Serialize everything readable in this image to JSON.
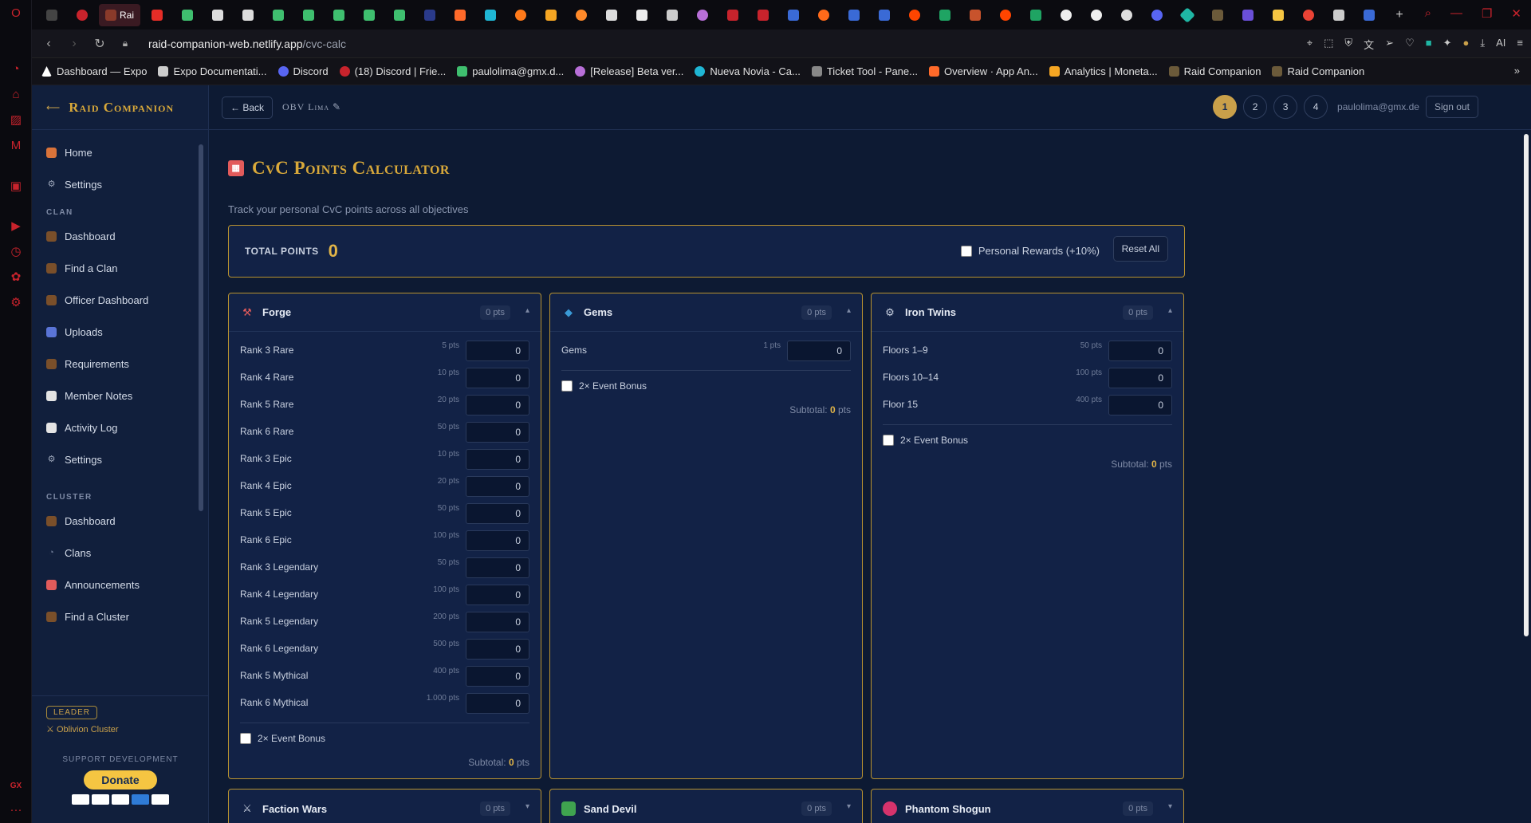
{
  "browser": {
    "active_tab_label": "Rai",
    "url_host": "raid-companion-web.netlify.app",
    "url_path": "/cvc-calc",
    "bookmarks": [
      {
        "label": "Dashboard — Expo",
        "color": "#ffffff"
      },
      {
        "label": "Expo Documentati...",
        "color": "#cccccc"
      },
      {
        "label": "Discord",
        "color": "#5865f2"
      },
      {
        "label": "(18) Discord | Frie...",
        "color": "#c8232c"
      },
      {
        "label": "paulolima@gmx.d...",
        "color": "#3fbf6f"
      },
      {
        "label": "[Release] Beta ver...",
        "color": "#b86fd8"
      },
      {
        "label": "Nueva Novia - Ca...",
        "color": "#1fb6d4"
      },
      {
        "label": "Ticket Tool - Pane...",
        "color": "#888888"
      },
      {
        "label": "Overview · App An...",
        "color": "#ff6a2a"
      },
      {
        "label": "Analytics | Moneta...",
        "color": "#f5a623"
      },
      {
        "label": "Raid Companion",
        "color": "#6b5a3a"
      },
      {
        "label": "Raid Companion",
        "color": "#6b5a3a"
      }
    ]
  },
  "brand": {
    "name": "Raid Companion"
  },
  "sidebar": {
    "top": [
      {
        "label": "Home",
        "icon": "house-icon",
        "color": "#d9733a"
      },
      {
        "label": "Settings",
        "icon": "gear-icon",
        "color": "#9aa4b8"
      }
    ],
    "clan_heading": "CLAN",
    "clan": [
      {
        "label": "Dashboard",
        "icon": "dashboard-icon",
        "color": "#7a4f2a"
      },
      {
        "label": "Find a Clan",
        "icon": "search-clan-icon",
        "color": "#7a4f2a"
      },
      {
        "label": "Officer Dashboard",
        "icon": "officer-icon",
        "color": "#7a4f2a"
      },
      {
        "label": "Uploads",
        "icon": "upload-icon",
        "color": "#5a74d6"
      },
      {
        "label": "Requirements",
        "icon": "requirements-icon",
        "color": "#7a4f2a"
      },
      {
        "label": "Member Notes",
        "icon": "notes-icon",
        "color": "#e4e4e4"
      },
      {
        "label": "Activity Log",
        "icon": "log-icon",
        "color": "#e4e4e4"
      },
      {
        "label": "Settings",
        "icon": "gear-icon",
        "color": "#9aa4b8"
      }
    ],
    "cluster_heading": "CLUSTER",
    "cluster": [
      {
        "label": "Dashboard",
        "icon": "dashboard-icon",
        "color": "#7a4f2a"
      },
      {
        "label": "Clans",
        "icon": "clans-icon",
        "color": "#6f7c98"
      },
      {
        "label": "Announcements",
        "icon": "megaphone-icon",
        "color": "#e25b5b"
      },
      {
        "label": "Find a Cluster",
        "icon": "search-cluster-icon",
        "color": "#7a4f2a"
      }
    ],
    "footer": {
      "role_badge": "LEADER",
      "cluster_name": "Oblivion Cluster",
      "support_label": "SUPPORT DEVELOPMENT",
      "donate_label": "Donate"
    }
  },
  "topbar": {
    "back_label": "← Back",
    "clan_name": "OBV Lima ✎",
    "slots": [
      "1",
      "2",
      "3",
      "4"
    ],
    "active_slot": "1",
    "email": "paulolima@gmx.de",
    "signout_label": "Sign out"
  },
  "page": {
    "title": "CvC Points Calculator",
    "subtitle": "Track your personal CvC points across all objectives",
    "total_label": "TOTAL POINTS",
    "total_value": "0",
    "personal_rewards_label": "Personal Rewards (+10%)",
    "reset_label": "Reset All",
    "event_bonus_label": "2× Event Bonus",
    "subtotal_label": "Subtotal:",
    "subtotal_suffix": "pts"
  },
  "categories": [
    {
      "name": "Forge",
      "icon": "hammers-icon",
      "pts_badge": "0 pts",
      "subtotal": "0",
      "rows": [
        {
          "label": "Rank 3 Rare",
          "pts": "5 pts",
          "value": "0"
        },
        {
          "label": "Rank 4 Rare",
          "pts": "10 pts",
          "value": "0"
        },
        {
          "label": "Rank 5 Rare",
          "pts": "20 pts",
          "value": "0"
        },
        {
          "label": "Rank 6 Rare",
          "pts": "50 pts",
          "value": "0"
        },
        {
          "label": "Rank 3 Epic",
          "pts": "10 pts",
          "value": "0"
        },
        {
          "label": "Rank 4 Epic",
          "pts": "20 pts",
          "value": "0"
        },
        {
          "label": "Rank 5 Epic",
          "pts": "50 pts",
          "value": "0"
        },
        {
          "label": "Rank 6 Epic",
          "pts": "100 pts",
          "value": "0"
        },
        {
          "label": "Rank 3 Legendary",
          "pts": "50 pts",
          "value": "0"
        },
        {
          "label": "Rank 4 Legendary",
          "pts": "100 pts",
          "value": "0"
        },
        {
          "label": "Rank 5 Legendary",
          "pts": "200 pts",
          "value": "0"
        },
        {
          "label": "Rank 6 Legendary",
          "pts": "500 pts",
          "value": "0"
        },
        {
          "label": "Rank 5 Mythical",
          "pts": "400 pts",
          "value": "0"
        },
        {
          "label": "Rank 6 Mythical",
          "pts": "1.000 pts",
          "value": "0"
        }
      ]
    },
    {
      "name": "Gems",
      "icon": "gem-icon",
      "pts_badge": "0 pts",
      "subtotal": "0",
      "rows": [
        {
          "label": "Gems",
          "pts": "1 pts",
          "value": "0"
        }
      ]
    },
    {
      "name": "Iron Twins",
      "icon": "gear-icon",
      "pts_badge": "0 pts",
      "subtotal": "0",
      "rows": [
        {
          "label": "Floors 1–9",
          "pts": "50 pts",
          "value": "0"
        },
        {
          "label": "Floors 10–14",
          "pts": "100 pts",
          "value": "0"
        },
        {
          "label": "Floor 15",
          "pts": "400 pts",
          "value": "0"
        }
      ]
    }
  ],
  "collapsed_categories": [
    {
      "name": "Faction Wars",
      "icon": "swords-icon",
      "pts_badge": "0 pts"
    },
    {
      "name": "Sand Devil",
      "icon": "sand-devil-icon",
      "pts_badge": "0 pts"
    },
    {
      "name": "Phantom Shogun",
      "icon": "oni-mask-icon",
      "pts_badge": "0 pts"
    }
  ]
}
